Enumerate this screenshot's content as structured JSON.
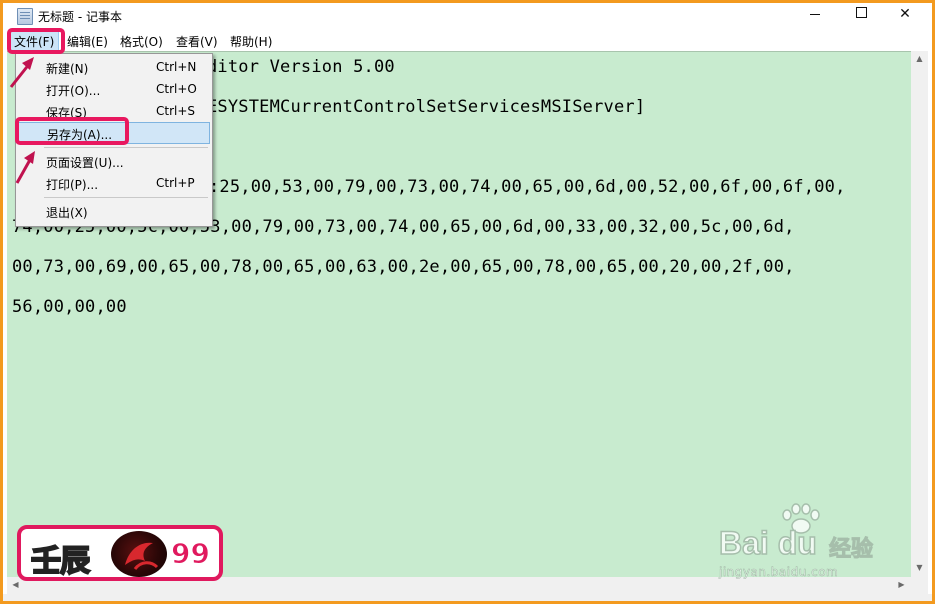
{
  "window": {
    "title": "无标题 - 记事本"
  },
  "menubar": {
    "file": "文件(F)",
    "edit": "编辑(E)",
    "format": "格式(O)",
    "view": "查看(V)",
    "help": "帮助(H)"
  },
  "file_menu": {
    "items": [
      {
        "label": "新建(N)",
        "shortcut": "Ctrl+N"
      },
      {
        "label": "打开(O)...",
        "shortcut": "Ctrl+O"
      },
      {
        "label": "保存(S)",
        "shortcut": "Ctrl+S"
      },
      {
        "label": "另存为(A)...",
        "shortcut": ""
      },
      {
        "label": "页面设置(U)...",
        "shortcut": ""
      },
      {
        "label": "打印(P)...",
        "shortcut": "Ctrl+P"
      },
      {
        "label": "退出(X)",
        "shortcut": ""
      }
    ]
  },
  "editor": {
    "lines": [
      "ditor Version 5.00",
      "ESYSTEMCurrentControlSetServicesMSIServer]",
      ":25,00,53,00,79,00,73,00,74,00,65,00,6d,00,52,00,6f,00,6f,00,",
      "74,00,25,00,5c,00,53,00,79,00,73,00,74,00,65,00,6d,00,33,00,32,00,5c,00,6d,",
      "00,73,00,69,00,65,00,78,00,65,00,63,00,2e,00,65,00,78,00,65,00,20,00,2f,00,",
      "56,00,00,00"
    ]
  },
  "watermark": {
    "badge_text": "壬辰",
    "badge_number": "99",
    "baidu_logo": "Bai du",
    "baidu_cn": "经验",
    "baidu_url": "jingyan.baidu.com"
  },
  "colors": {
    "editor_background": "#c8ebcf",
    "highlight": "#e8185f",
    "frame": "#f39a1f"
  }
}
